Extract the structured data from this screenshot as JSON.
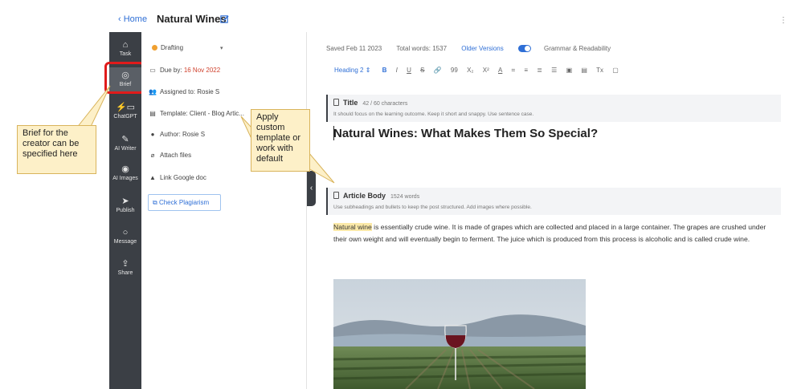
{
  "header": {
    "back_label": "Home",
    "title": "Natural Wines"
  },
  "rail": {
    "items": [
      {
        "label": "Task",
        "icon": "home-icon"
      },
      {
        "label": "Brief",
        "icon": "target-icon"
      },
      {
        "label": "ChatGPT",
        "icon": "chatgpt-icon"
      },
      {
        "label": "AI Writer",
        "icon": "magic-wand-icon"
      },
      {
        "label": "AI Images",
        "icon": "palette-icon"
      },
      {
        "label": "Publish",
        "icon": "send-icon"
      },
      {
        "label": "Message",
        "icon": "chat-bubble-icon"
      },
      {
        "label": "Share",
        "icon": "share-icon"
      }
    ]
  },
  "brief": {
    "status": "Drafting",
    "due_label": "Due by:",
    "due_date": "16 Nov 2022",
    "assigned": "Assigned to: Rosie S",
    "template": "Template: Client - Blog Artic...",
    "author": "Author: Rosie S",
    "attach": "Attach files",
    "link_doc": "Link Google doc",
    "check_plagiarism": "Check Plagiarism"
  },
  "editor": {
    "saved": "Saved Feb 11 2023",
    "total_words": "Total words: 1537",
    "older_versions": "Older Versions",
    "grammar": "Grammar & Readability",
    "toolbar": {
      "heading": "Heading 2 ⇕",
      "buttons": [
        "B",
        "I",
        "U",
        "S",
        "🔗",
        "99",
        "X₂",
        "X²",
        "A",
        "⌗",
        "≡",
        "≣",
        "☰",
        "▣",
        "▤",
        "Tx",
        "▢"
      ]
    },
    "title_section": {
      "label": "Title",
      "count": "42 / 60 characters",
      "hint": "It should focus on the learning outcome. Keep it short and snappy. Use sentence case."
    },
    "title_text": "Natural Wines: What Makes Them So Special?",
    "body_section": {
      "label": "Article Body",
      "count": "1524 words",
      "hint": "Use subheadings and bullets to keep the post structured. Add images where possible."
    },
    "body_highlight": "Natural wine",
    "body_text": " is essentially crude wine. It is made of grapes which are collected and placed in a large container. The grapes are crushed under their own weight and will eventually begin to ferment. The juice which is produced from this process is alcoholic and is called crude wine."
  },
  "callouts": {
    "brief": "Brief for the creator can be specified here",
    "template": "Apply custom template or work with default"
  },
  "colors": {
    "accent": "#2f6fd6",
    "rail": "#3b3f45",
    "due": "#d0422e",
    "status": "#f0a030",
    "highlight_box": "#e01b1b",
    "callout_bg": "#fdf0c8"
  }
}
